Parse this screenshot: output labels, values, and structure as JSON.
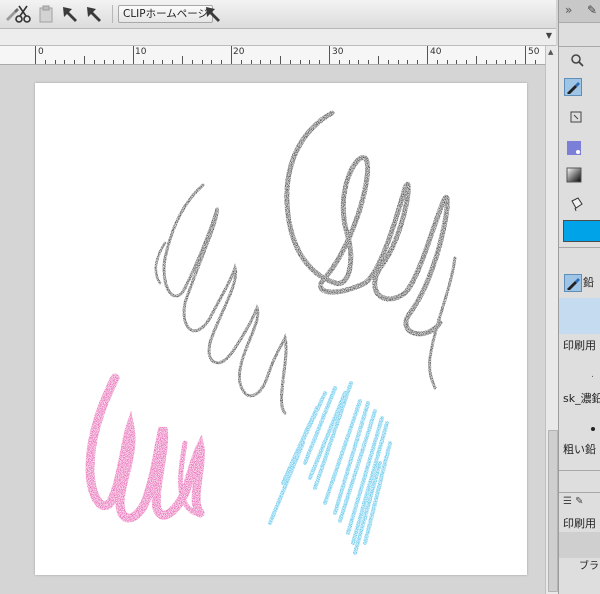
{
  "toolbar": {
    "clip_home_label": "CLIPホームページ",
    "icons": [
      "brush-icon",
      "scissors-icon",
      "clipboard-icon",
      "arrow-icon",
      "arrow-icon",
      "arrow-icon"
    ]
  },
  "ruler": {
    "labels": [
      "0",
      "10",
      "20",
      "30",
      "40",
      "50"
    ]
  },
  "canvas": {
    "strokes": [
      "black",
      "pink",
      "cyan"
    ],
    "colors": {
      "black": "#1a1a1a",
      "pink": "#e0339a",
      "cyan": "#2ab4e6"
    }
  },
  "panel": {
    "color_hex": "#00a2e8",
    "label_1": "鉛",
    "label_2": "印刷用",
    "label_3": ".",
    "label_4": "sk_濃鉛",
    "label_5": "粗い鉛",
    "label_6": "印刷用",
    "label_7": "ブラ"
  }
}
